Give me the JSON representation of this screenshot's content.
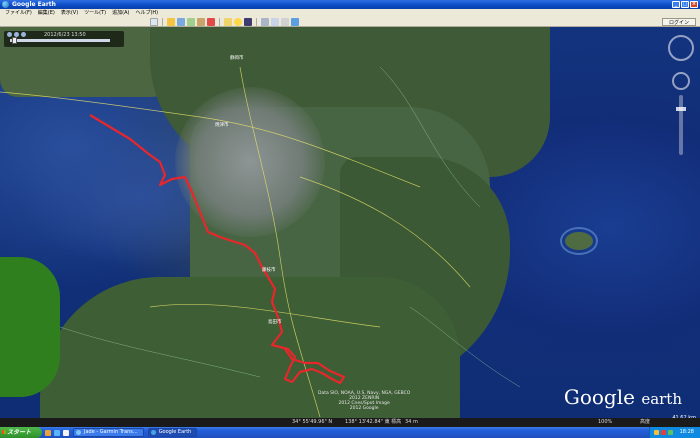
{
  "window": {
    "title": "Google Earth",
    "buttons": [
      "_",
      "□",
      "×"
    ]
  },
  "menu": [
    "ファイル(F)",
    "編集(E)",
    "表示(V)",
    "ツール(T)",
    "追加(A)",
    "ヘルプ(H)"
  ],
  "toolbar": {
    "signin_label": "ログイン"
  },
  "time_slider": {
    "date_label": "2012/6/23 13:50"
  },
  "map": {
    "place_labels": [
      "静岡市",
      "焼津市",
      "藤枝市",
      "島田市"
    ],
    "copyright_lines": [
      "Data SIO, NOAA, U.S. Navy, NGA, GEBCO",
      "2012 ZENRIN",
      "2012 Cnes/Spot Image",
      "2012 Google"
    ],
    "logo_google": "Google",
    "logo_earth": "earth",
    "eye_altitude": "41.62 km"
  },
  "status_bar": {
    "lat": "34° 55'49.96\" N",
    "lon": "138° 13'42.84\" 東 標高",
    "elev": "34 m",
    "streaming": "100%",
    "right": "高度"
  },
  "taskbar": {
    "start_label": "スタート",
    "tasks": [
      "Jade - Garmin Trans...",
      "Google Earth"
    ],
    "clock": "18:28"
  }
}
